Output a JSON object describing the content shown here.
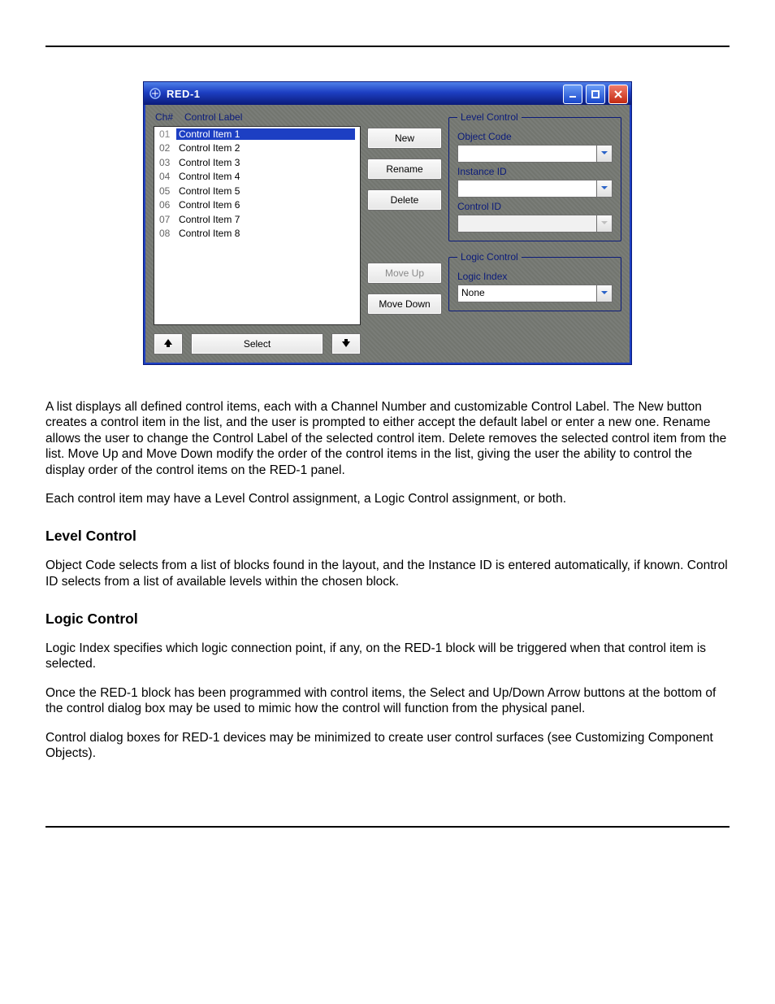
{
  "window": {
    "title": "RED-1",
    "list_headers": {
      "ch": "Ch#",
      "label": "Control Label"
    },
    "items": [
      {
        "ch": "01",
        "label": "Control Item 1",
        "selected": true
      },
      {
        "ch": "02",
        "label": "Control Item 2",
        "selected": false
      },
      {
        "ch": "03",
        "label": "Control Item 3",
        "selected": false
      },
      {
        "ch": "04",
        "label": "Control Item 4",
        "selected": false
      },
      {
        "ch": "05",
        "label": "Control Item 5",
        "selected": false
      },
      {
        "ch": "06",
        "label": "Control Item 6",
        "selected": false
      },
      {
        "ch": "07",
        "label": "Control Item 7",
        "selected": false
      },
      {
        "ch": "08",
        "label": "Control Item 8",
        "selected": false
      }
    ],
    "buttons": {
      "new": "New",
      "rename": "Rename",
      "delete": "Delete",
      "move_up": "Move Up",
      "move_down": "Move Down",
      "select": "Select"
    },
    "level_group": {
      "legend": "Level Control",
      "object_code": {
        "label": "Object Code",
        "value": ""
      },
      "instance_id": {
        "label": "Instance ID",
        "value": ""
      },
      "control_id": {
        "label": "Control ID",
        "value": ""
      }
    },
    "logic_group": {
      "legend": "Logic Control",
      "logic_index": {
        "label": "Logic Index",
        "value": "None"
      }
    }
  },
  "doc": {
    "p1": "A list displays all defined control items, each with a Channel Number and customizable Control Label. The New button creates a control item in the list, and the user is prompted to either accept the default label or enter a new one. Rename allows the user to change the Control Label of the selected control item. Delete removes the selected control item from the list. Move Up and Move Down modify the order of the control items in the list, giving the user the ability to control the display order of the control items on the RED-1 panel.",
    "p2": "Each control item may have a Level Control assignment, a Logic Control assignment, or both.",
    "h1": "Level Control",
    "p3": "Object Code selects from a list of blocks found in the layout, and the Instance ID is entered automatically, if known. Control ID selects from a list of available levels within the chosen block.",
    "h2": "Logic Control",
    "p4": "Logic Index specifies which logic connection point, if any, on the RED-1 block will be triggered when that control item is selected.",
    "p5": "Once the RED-1 block has been programmed with control items, the Select and Up/Down Arrow buttons at the bottom of the control dialog box may be used to mimic how the control will function from the physical panel.",
    "p6": "Control dialog boxes for RED-1 devices may be minimized to create user control surfaces (see Customizing Component Objects)."
  }
}
